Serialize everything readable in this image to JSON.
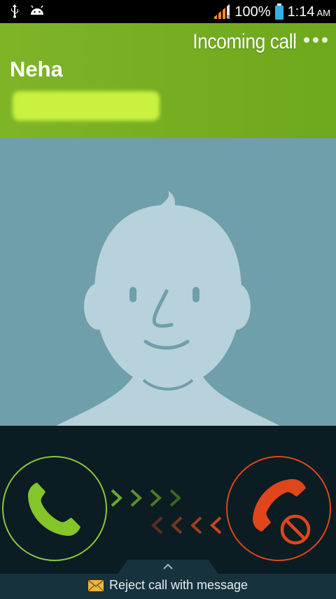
{
  "status_bar": {
    "icons": [
      "usb-icon",
      "android-debug-icon",
      "signal-icon",
      "battery-icon"
    ],
    "battery_percent": "100%",
    "time": "1:14",
    "ampm": "AM"
  },
  "header": {
    "incoming_label": "Incoming call",
    "caller_name": "Neha"
  },
  "actions": {
    "accept_icon": "phone-accept-icon",
    "reject_icon": "phone-reject-icon",
    "reject_message_label": "Reject call with message"
  },
  "colors": {
    "header_green": "#7fb427",
    "avatar_bg": "#6f9faa",
    "accept_green": "#89c83a",
    "reject_red": "#e0451b"
  }
}
